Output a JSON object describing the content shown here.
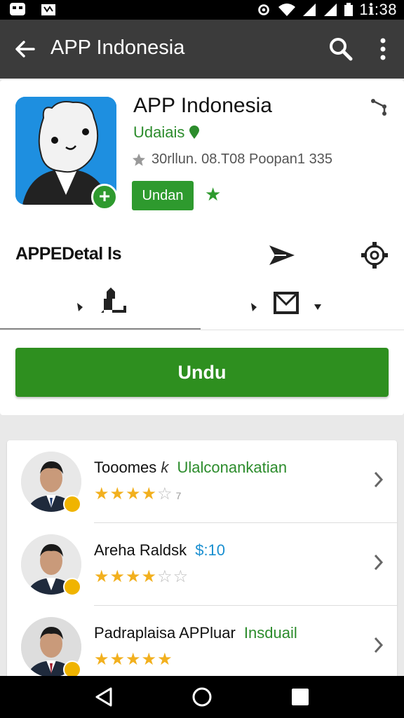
{
  "status_bar": {
    "time": "1ℹ:38"
  },
  "toolbar": {
    "title": "APP Indonesia",
    "back_icon": "arrow-back-icon",
    "search_icon": "search-icon",
    "more_icon": "more-vert-icon"
  },
  "app": {
    "name": "APP Indonesia",
    "developer": "Udaiais",
    "meta": "30rllun. 08.T08 Poopan1 335",
    "install_chip": "Undan",
    "details_label": "APPEDetal ls",
    "primary_button": "Undu"
  },
  "reviews": [
    {
      "name": "Tooomes",
      "separator": "k",
      "tag": "Ulalconankatian",
      "tag_color": "#2c8c2c",
      "rating": 4,
      "count": "7"
    },
    {
      "name": "Areha Raldsk",
      "separator": "",
      "tag": "$:10",
      "tag_color": "#1a8fd0",
      "rating": 4,
      "count": ""
    },
    {
      "name": "Padraplaisa APPluar",
      "separator": "",
      "tag": "Insduail",
      "tag_color": "#2c8c2c",
      "rating": 5,
      "count": ""
    }
  ],
  "colors": {
    "toolbar": "#3b3b3b",
    "accent_green": "#2e8f1f",
    "star": "#f2b01e",
    "app_icon_bg": "#1e8fe0"
  }
}
